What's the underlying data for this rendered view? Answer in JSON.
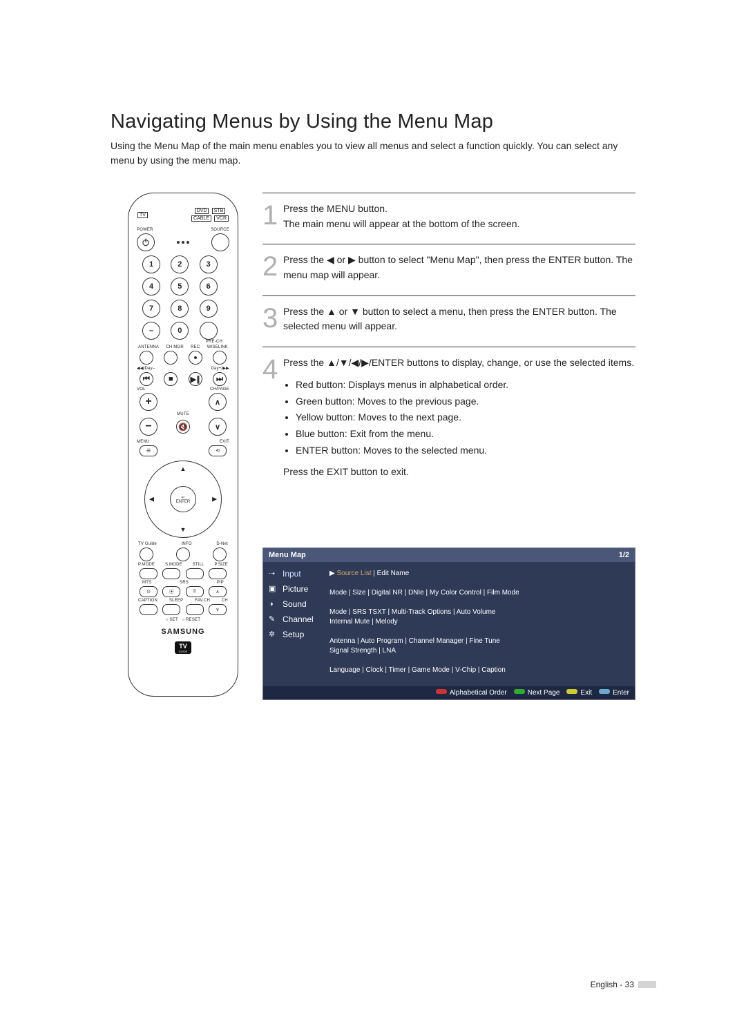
{
  "title": "Navigating Menus by Using the Menu Map",
  "intro": "Using the Menu Map of the main menu enables you to view all menus and select a function quickly. You can select any menu by using the menu map.",
  "steps": [
    {
      "num": "1",
      "line1": "Press the MENU button.",
      "line2": "The main menu will appear at the bottom of the screen."
    },
    {
      "num": "2",
      "line1": "Press the ◀ or ▶ button to select \"Menu Map\", then press the ENTER button. The menu map will appear."
    },
    {
      "num": "3",
      "line1": "Press the ▲ or ▼ button to select a menu, then press the ENTER button. The selected menu will appear."
    },
    {
      "num": "4",
      "line1": "Press the ▲/▼/◀/▶/ENTER buttons to display, change, or use the selected items.",
      "bullets": [
        "Red button: Displays menus in alphabetical order.",
        "Green button: Moves to the previous page.",
        "Yellow button: Moves to the next page.",
        "Blue button: Exit from the menu.",
        "ENTER button: Moves to the selected menu."
      ],
      "after": "Press the EXIT button to exit."
    }
  ],
  "remote": {
    "device": [
      "TV",
      "DVD",
      "STB",
      "CABLE",
      "VCR"
    ],
    "power": "POWER",
    "source": "SOURCE",
    "numbers": [
      "1",
      "2",
      "3",
      "4",
      "5",
      "6",
      "7",
      "8",
      "9",
      "–",
      "0",
      ""
    ],
    "prech": "PRE-CH",
    "row_labels": [
      "ANTENNA",
      "CH MGR",
      "REC",
      "WISELINK"
    ],
    "transport_l": "◀◀/Day–",
    "transport_r": "Day+/▶▶",
    "vol": "VOL",
    "chpage": "CH/PAGE",
    "mute": "MUTE",
    "menu": "MENU",
    "exit": "EXIT",
    "enter": "ENTER",
    "bottom_row": [
      "TV Guide",
      "INFO",
      "D-Net"
    ],
    "modes": [
      "P.MODE",
      "S.MODE",
      "STILL",
      "P.SIZE"
    ],
    "modes2": [
      "MTS",
      "SRS",
      "PIP"
    ],
    "modes3": [
      "CAPTION",
      "SLEEP",
      "FAV.CH",
      "CH"
    ],
    "setreset": [
      "SET",
      "RESET"
    ],
    "brand": "SAMSUNG",
    "tvguide_logo": "TV",
    "tvguide_sub": "GUIDE"
  },
  "osd": {
    "title": "Menu Map",
    "page": "1/2",
    "items": [
      {
        "icon": "⇢",
        "label": "Input",
        "sel": true,
        "value_hl": "Source List",
        "value": " | Edit Name"
      },
      {
        "icon": "▣",
        "label": "Picture",
        "value": "Mode | Size | Digital NR | DNIe | My Color Control | Film Mode"
      },
      {
        "icon": "◑",
        "label": "Sound",
        "value": "Mode | SRS TSXT | Multi-Track Options | Auto Volume\nInternal Mute | Melody"
      },
      {
        "icon": "✎",
        "label": "Channel",
        "value": "Antenna | Auto Program | Channel Manager | Fine Tune\nSignal Strength | LNA"
      },
      {
        "icon": "✲",
        "label": "Setup",
        "value": "Language | Clock | Timer | Game Mode | V-Chip | Caption"
      }
    ],
    "footer": [
      "Alphabetical Order",
      "Next Page",
      "Exit",
      "Enter"
    ]
  },
  "footer": "English - 33"
}
